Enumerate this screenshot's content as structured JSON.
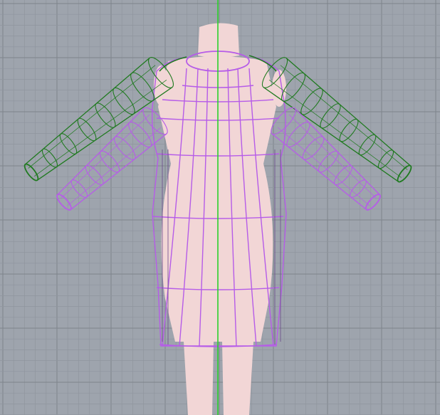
{
  "viewport": {
    "background_color": "#9ea4ad",
    "grid_minor_color": "#8f959e",
    "grid_major_color": "#7e848c",
    "axis_color": "#2bd12b",
    "mannequin_color": "#f2d6d6",
    "garment_base_color": "#b65ce8",
    "garment_sleeve_color": "#1f7a1f",
    "view": "front"
  }
}
